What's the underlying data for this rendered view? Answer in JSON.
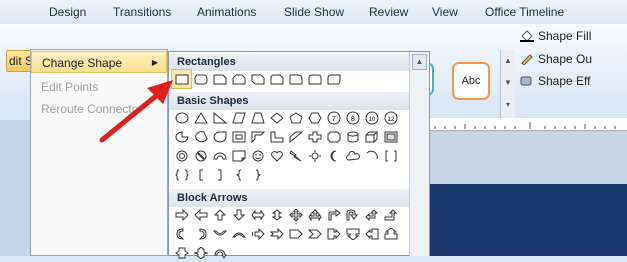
{
  "ribbon_tabs": [
    "Design",
    "Transitions",
    "Animations",
    "Slide Show",
    "Review",
    "View",
    "Office Timeline"
  ],
  "edit_shape_label": "dit Shape",
  "menu": {
    "items": [
      {
        "label": "Change Shape",
        "state": "highlighted"
      },
      {
        "label": "Edit Points",
        "state": "disabled"
      },
      {
        "label": "Reroute Connecto",
        "state": "disabled"
      }
    ]
  },
  "gallery_thumb_colors": [
    "#000000",
    "#4f81bd",
    "#c0504d",
    "#9bbb59",
    "#8064a2",
    "#4bacc6"
  ],
  "abc_thumb": {
    "label": "Abc",
    "color": "#f79646"
  },
  "format_items": [
    "Shape Fill",
    "Shape Ou",
    "Shape Eff"
  ],
  "sections": [
    {
      "title": "Rectangles",
      "count": 9
    },
    {
      "title": "Basic Shapes",
      "count": 42
    },
    {
      "title": "Block Arrows",
      "count": 26
    }
  ],
  "accent": "#e01e1e"
}
